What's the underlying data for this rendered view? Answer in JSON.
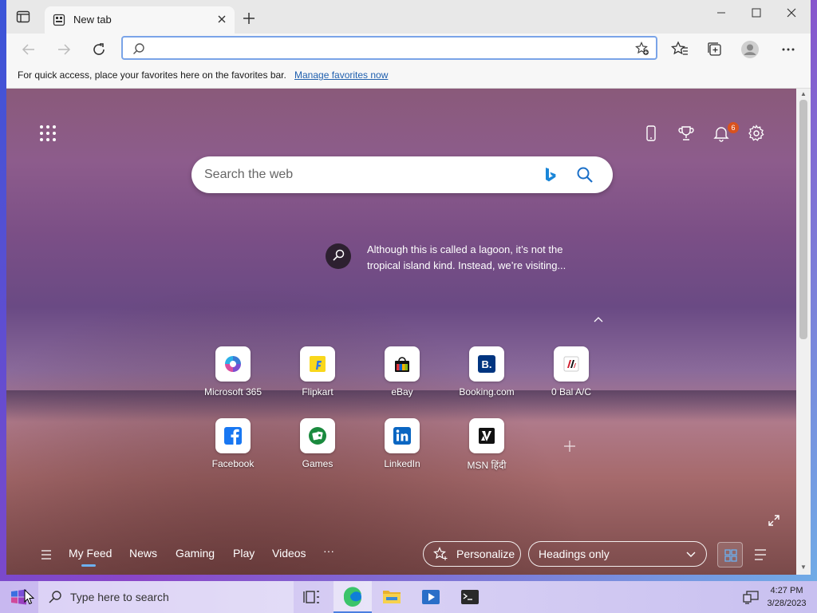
{
  "browser": {
    "tab_title": "New tab",
    "address_value": "",
    "favorites_bar": {
      "message": "For quick access, place your favorites here on the favorites bar.",
      "link": "Manage favorites now"
    }
  },
  "newtab": {
    "notification_count": "6",
    "search_placeholder": "Search the web",
    "insight_text": "Although this is called a lagoon, it’s not the tropical island kind. Instead, we’re visiting...",
    "quick_links": [
      {
        "label": "Microsoft 365",
        "icon": "microsoft-365-icon"
      },
      {
        "label": "Flipkart",
        "icon": "flipkart-icon"
      },
      {
        "label": "eBay",
        "icon": "ebay-icon"
      },
      {
        "label": "Booking.com",
        "icon": "booking-icon"
      },
      {
        "label": "0 Bal A/C",
        "icon": "bank-icon"
      },
      {
        "label": "Facebook",
        "icon": "facebook-icon"
      },
      {
        "label": "Games",
        "icon": "games-icon"
      },
      {
        "label": "LinkedIn",
        "icon": "linkedin-icon"
      },
      {
        "label": "MSN हिंदी",
        "icon": "msn-icon"
      }
    ],
    "feed_tabs": [
      "My Feed",
      "News",
      "Gaming",
      "Play",
      "Videos",
      "···"
    ],
    "personalize_label": "Personalize",
    "headings_select": "Headings only"
  },
  "taskbar": {
    "search_placeholder": "Type here to search",
    "time": "4:27 PM",
    "date": "3/28/2023"
  },
  "colors": {
    "accent": "#1f5fae",
    "badge": "#d9521e",
    "active_tab_underline": "#6cb0f0"
  }
}
